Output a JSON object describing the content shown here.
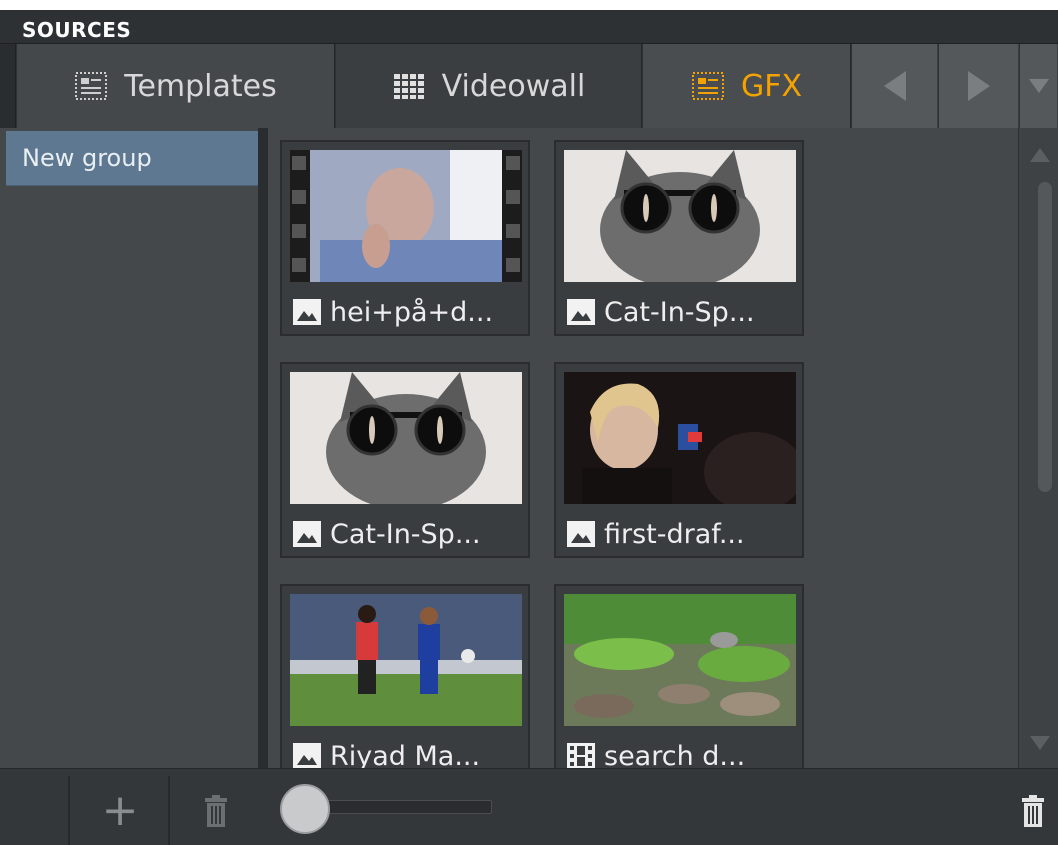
{
  "panel": {
    "title": "SOURCES"
  },
  "tabs": [
    {
      "label": "Templates",
      "icon": "template-icon",
      "state": "normal"
    },
    {
      "label": "Videowall",
      "icon": "videowall-icon",
      "state": "active"
    },
    {
      "label": "GFX",
      "icon": "gfx-icon",
      "state": "selected"
    }
  ],
  "nav": {
    "prev": "previous-arrow-icon",
    "next": "next-arrow-icon",
    "menu": "dropdown-arrow-icon"
  },
  "groups": [
    {
      "label": "New group"
    }
  ],
  "items": [
    {
      "caption": "hei+på+d...",
      "type": "image"
    },
    {
      "caption": "Cat-In-Sp...",
      "type": "image"
    },
    {
      "caption": "Cat-In-Sp...",
      "type": "image"
    },
    {
      "caption": "first-draf...",
      "type": "image"
    },
    {
      "caption": "Riyad Ma...",
      "type": "image"
    },
    {
      "caption": "search d...",
      "type": "video"
    }
  ],
  "bottom": {
    "add_label": "+",
    "delete_group_icon": "trash-icon",
    "delete_item_icon": "trash-icon"
  },
  "colors": {
    "accent": "#f2a300",
    "selection": "#5e7891",
    "panel": "#45484b"
  }
}
